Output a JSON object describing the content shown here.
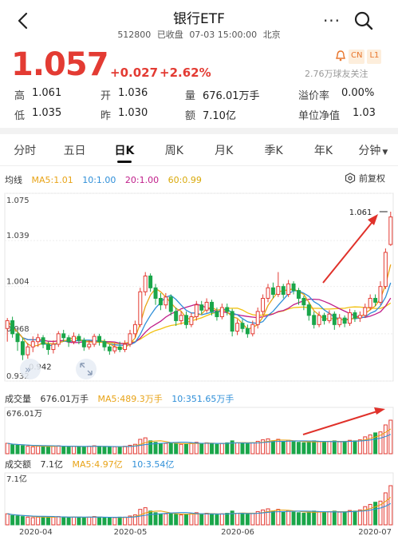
{
  "header": {
    "title": "银行ETF",
    "code": "512800",
    "status": "已收盘",
    "datetime": "07-03 15:00:00",
    "location": "北京",
    "more_label": "···"
  },
  "quote": {
    "price": "1.057",
    "change": "+0.027",
    "change_pct": "+2.62%",
    "tags": [
      "CN",
      "L1"
    ],
    "followers": "2.76万球友关注",
    "up_color": "#e33b33",
    "down_color": "#1aa64a"
  },
  "stats": {
    "high_label": "高",
    "high": "1.061",
    "open_label": "开",
    "open": "1.036",
    "volume_label": "量",
    "volume": "676.01万手",
    "premium_label": "溢价率",
    "premium": "0.00%",
    "low_label": "低",
    "low": "1.035",
    "prev_label": "昨",
    "prev": "1.030",
    "amount_label": "额",
    "amount": "7.10亿",
    "nav_label": "单位净值",
    "nav": "1.03"
  },
  "tabs": [
    "分时",
    "五日",
    "日K",
    "周K",
    "月K",
    "季K",
    "年K",
    "分钟"
  ],
  "active_tab": "日K",
  "ma_legend": {
    "title": "均线",
    "ma5": "MA5:1.01",
    "ma10": "10:1.00",
    "ma20": "20:1.00",
    "ma60": "60:0.99",
    "restore_label": "前复权",
    "colors": {
      "ma5": "#e8a317",
      "ma10": "#2f8fd8",
      "ma20": "#c01e8a",
      "ma60": "#f2c10f"
    }
  },
  "volume_legend": {
    "title": "成交量",
    "value": "676.01万手",
    "ma5": "MA5:489.3万手",
    "ma10": "10:351.65万手",
    "axis_max": "676.01万"
  },
  "amount_legend": {
    "title": "成交额",
    "value": "7.1亿",
    "ma5": "MA5:4.97亿",
    "ma10": "10:3.54亿",
    "axis_max": "7.1亿"
  },
  "chart_data": {
    "type": "candlestick",
    "y_ticks": [
      "1.075",
      "1.039",
      "1.004",
      "0.968",
      "0.932"
    ],
    "ylim": [
      0.932,
      1.075
    ],
    "annotations": {
      "high_label": "1.061",
      "low_label": "0.942"
    },
    "x_ticks": [
      "2020-04",
      "2020-05",
      "2020-06",
      "2020-07"
    ],
    "candles": [
      [
        0.972,
        0.978,
        0.962,
        0.98
      ],
      [
        0.978,
        0.968,
        0.965,
        0.981
      ],
      [
        0.968,
        0.962,
        0.955,
        0.97
      ],
      [
        0.962,
        0.952,
        0.948,
        0.965
      ],
      [
        0.952,
        0.958,
        0.949,
        0.961
      ],
      [
        0.958,
        0.962,
        0.954,
        0.966
      ],
      [
        0.962,
        0.965,
        0.958,
        0.968
      ],
      [
        0.965,
        0.96,
        0.957,
        0.967
      ],
      [
        0.96,
        0.956,
        0.952,
        0.962
      ],
      [
        0.956,
        0.96,
        0.953,
        0.963
      ],
      [
        0.96,
        0.968,
        0.958,
        0.97
      ],
      [
        0.968,
        0.965,
        0.962,
        0.971
      ],
      [
        0.965,
        0.962,
        0.958,
        0.967
      ],
      [
        0.962,
        0.966,
        0.96,
        0.969
      ],
      [
        0.966,
        0.963,
        0.96,
        0.968
      ],
      [
        0.963,
        0.958,
        0.955,
        0.965
      ],
      [
        0.958,
        0.96,
        0.956,
        0.963
      ],
      [
        0.96,
        0.966,
        0.958,
        0.968
      ],
      [
        0.966,
        0.962,
        0.959,
        0.968
      ],
      [
        0.962,
        0.958,
        0.955,
        0.964
      ],
      [
        0.958,
        0.955,
        0.952,
        0.96
      ],
      [
        0.955,
        0.958,
        0.953,
        0.961
      ],
      [
        0.958,
        0.956,
        0.954,
        0.962
      ],
      [
        0.956,
        0.96,
        0.954,
        0.963
      ],
      [
        0.96,
        0.968,
        0.958,
        0.971
      ],
      [
        0.968,
        0.975,
        0.965,
        0.978
      ],
      [
        0.975,
        1.0,
        0.973,
        1.003
      ],
      [
        1.0,
        1.012,
        0.997,
        1.015
      ],
      [
        1.012,
        1.003,
        1.0,
        1.014
      ],
      [
        1.003,
        0.995,
        0.99,
        1.006
      ],
      [
        0.995,
        0.99,
        0.986,
        0.999
      ],
      [
        0.99,
        0.996,
        0.987,
        0.999
      ],
      [
        0.996,
        0.985,
        0.982,
        0.998
      ],
      [
        0.985,
        0.978,
        0.974,
        0.988
      ],
      [
        0.978,
        0.982,
        0.975,
        0.985
      ],
      [
        0.982,
        0.975,
        0.972,
        0.985
      ],
      [
        0.975,
        0.981,
        0.973,
        0.984
      ],
      [
        0.981,
        0.99,
        0.978,
        0.993
      ],
      [
        0.99,
        0.986,
        0.983,
        0.993
      ],
      [
        0.986,
        0.992,
        0.984,
        0.995
      ],
      [
        0.992,
        0.985,
        0.982,
        0.994
      ],
      [
        0.985,
        0.981,
        0.978,
        0.988
      ],
      [
        0.981,
        0.988,
        0.979,
        0.991
      ],
      [
        0.988,
        0.985,
        0.982,
        0.991
      ],
      [
        0.985,
        0.97,
        0.966,
        0.987
      ],
      [
        0.97,
        0.976,
        0.967,
        0.979
      ],
      [
        0.976,
        0.972,
        0.969,
        0.979
      ],
      [
        0.972,
        0.968,
        0.965,
        0.975
      ],
      [
        0.968,
        0.975,
        0.966,
        0.978
      ],
      [
        0.975,
        0.985,
        0.972,
        0.988
      ],
      [
        0.985,
        0.995,
        0.982,
        0.998
      ],
      [
        0.995,
        1.003,
        0.992,
        1.006
      ],
      [
        1.003,
        0.998,
        0.995,
        1.007
      ],
      [
        0.998,
        1.004,
        0.996,
        1.015
      ],
      [
        1.004,
        0.998,
        0.995,
        1.006
      ],
      [
        0.998,
        1.006,
        0.996,
        1.009
      ],
      [
        1.006,
        1.001,
        0.998,
        1.008
      ],
      [
        1.001,
        0.995,
        0.99,
        1.003
      ],
      [
        0.995,
        0.99,
        0.986,
        0.997
      ],
      [
        0.99,
        0.982,
        0.978,
        0.992
      ],
      [
        0.982,
        0.975,
        0.972,
        0.985
      ],
      [
        0.975,
        0.982,
        0.973,
        0.985
      ],
      [
        0.982,
        0.978,
        0.975,
        0.984
      ],
      [
        0.978,
        0.983,
        0.976,
        0.986
      ],
      [
        0.983,
        0.975,
        0.971,
        0.985
      ],
      [
        0.975,
        0.98,
        0.973,
        0.983
      ],
      [
        0.98,
        0.976,
        0.973,
        0.982
      ],
      [
        0.976,
        0.984,
        0.974,
        0.987
      ],
      [
        0.984,
        0.98,
        0.977,
        0.986
      ],
      [
        0.98,
        0.982,
        0.977,
        0.985
      ],
      [
        0.982,
        0.988,
        0.98,
        0.991
      ],
      [
        0.988,
        0.995,
        0.986,
        0.998
      ],
      [
        0.995,
        0.992,
        0.989,
        0.998
      ],
      [
        0.992,
        1.004,
        0.99,
        1.008
      ],
      [
        1.004,
        1.03,
        1.002,
        1.033
      ],
      [
        1.036,
        1.057,
        1.035,
        1.061
      ]
    ],
    "volume": [
      210,
      180,
      170,
      160,
      150,
      140,
      150,
      155,
      145,
      150,
      160,
      150,
      140,
      150,
      145,
      140,
      150,
      160,
      150,
      140,
      135,
      140,
      145,
      150,
      170,
      190,
      290,
      320,
      260,
      230,
      200,
      210,
      220,
      200,
      190,
      200,
      210,
      230,
      210,
      220,
      200,
      190,
      210,
      220,
      260,
      220,
      210,
      200,
      220,
      250,
      280,
      300,
      260,
      290,
      250,
      270,
      240,
      230,
      220,
      240,
      260,
      250,
      240,
      250,
      260,
      240,
      250,
      270,
      260,
      280,
      340,
      380,
      420,
      440,
      580,
      676
    ],
    "amount": [
      2.0,
      1.7,
      1.6,
      1.5,
      1.4,
      1.3,
      1.4,
      1.5,
      1.4,
      1.4,
      1.5,
      1.4,
      1.3,
      1.4,
      1.4,
      1.3,
      1.4,
      1.5,
      1.4,
      1.3,
      1.3,
      1.3,
      1.4,
      1.4,
      1.6,
      1.8,
      2.8,
      3.1,
      2.5,
      2.2,
      1.9,
      2.0,
      2.1,
      1.9,
      1.8,
      1.9,
      2.0,
      2.2,
      2.0,
      2.1,
      1.9,
      1.8,
      2.0,
      2.1,
      2.5,
      2.1,
      2.0,
      1.9,
      2.1,
      2.4,
      2.7,
      2.9,
      2.5,
      2.8,
      2.4,
      2.6,
      2.3,
      2.2,
      2.1,
      2.3,
      2.5,
      2.4,
      2.3,
      2.4,
      2.5,
      2.3,
      2.4,
      2.6,
      2.5,
      2.7,
      3.3,
      3.7,
      4.1,
      4.3,
      5.8,
      7.1
    ]
  }
}
